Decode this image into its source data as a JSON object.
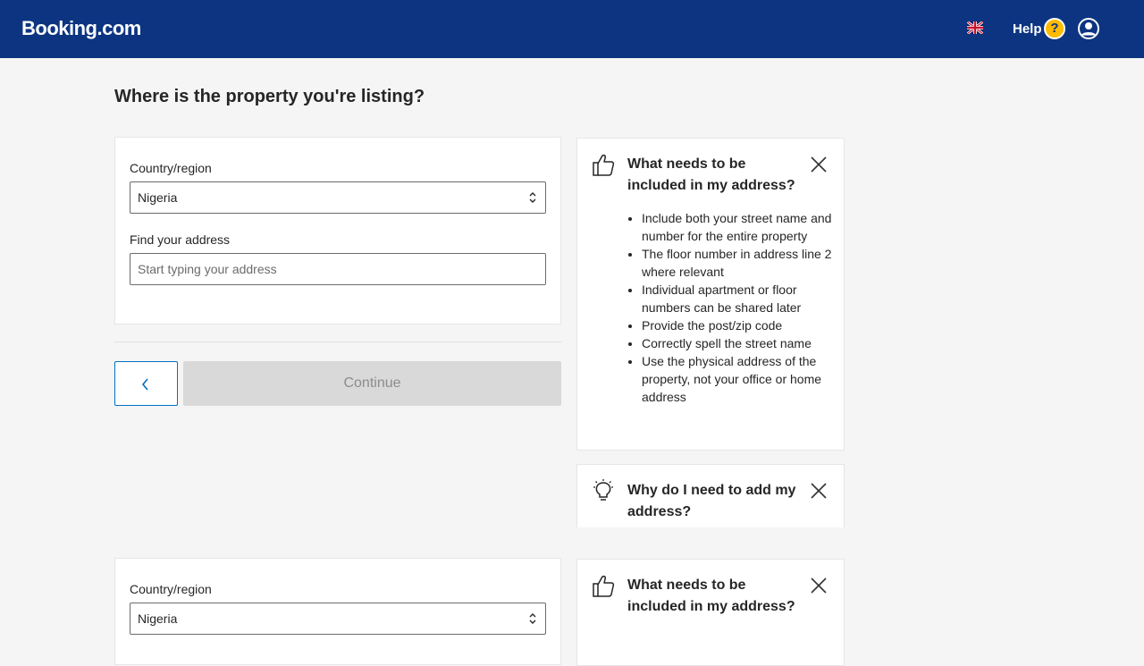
{
  "header": {
    "logo": "Booking.com",
    "help_label": "Help",
    "help_icon": "?",
    "language_icon": "uk-flag-icon",
    "account_icon": "user-icon"
  },
  "page_title": "Where is the property you're listing?",
  "form": {
    "country_label": "Country/region",
    "country_value": "Nigeria",
    "address_label": "Find your address",
    "address_placeholder": "Start typing your address",
    "continue_label": "Continue"
  },
  "tips": {
    "address_tip": {
      "title": "What needs to be included in my address?",
      "items": [
        "Include both your street name and number for the entire property",
        "The floor number in address line 2 where relevant",
        "Individual apartment or floor numbers can be shared later",
        "Provide the post/zip code",
        "Correctly spell the street name",
        "Use the physical address of the property, not your office or home address"
      ]
    },
    "why_tip": {
      "title": "Why do I need to add my address?"
    }
  },
  "duplicate": {
    "country_label": "Country/region",
    "country_value": "Nigeria",
    "tip_title": "What needs to be included in my address?"
  },
  "colors": {
    "brand_blue": "#0c3481",
    "accent_blue": "#0071c2",
    "help_yellow": "#febb02"
  }
}
